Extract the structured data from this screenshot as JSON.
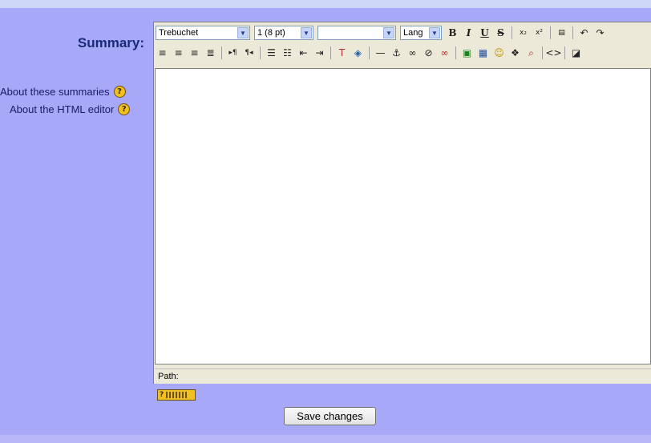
{
  "form": {
    "summary_label": "Summary:",
    "help_links": [
      {
        "label": "About these summaries"
      },
      {
        "label": "About the HTML editor"
      }
    ],
    "save_label": "Save changes"
  },
  "editor": {
    "font_select": "Trebuchet",
    "size_select": "1 (8 pt)",
    "style_select": "",
    "lang_select": "Lang",
    "path_label": "Path:",
    "content": ""
  },
  "colors": {
    "page_bg": "#a8a8f8",
    "label_color": "#1a2a7a",
    "toolbar_bg": "#ece9d8"
  }
}
